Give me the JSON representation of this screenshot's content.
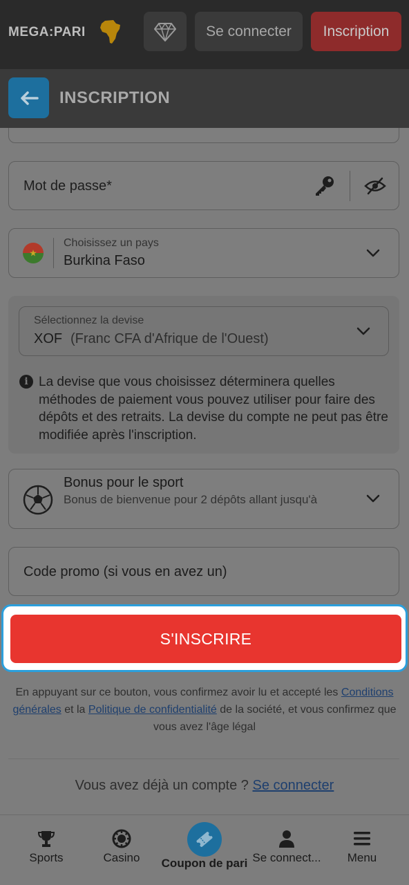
{
  "topbar": {
    "logo_text": "MEGA:PARI",
    "login_label": "Se connecter",
    "signup_label": "Inscription"
  },
  "header": {
    "title": "INSCRIPTION"
  },
  "form": {
    "password_placeholder": "Mot de passe*",
    "country": {
      "label": "Choisissez un pays",
      "value": "Burkina Faso"
    },
    "currency": {
      "label": "Sélectionnez la devise",
      "code": "XOF",
      "name": "(Franc CFA d'Afrique de l'Ouest)",
      "info": "La devise que vous choisissez déterminera quelles méthodes de paiement vous pouvez utiliser pour faire des dépôts et des retraits. La devise du compte ne peut pas être modifiée après l'inscription."
    },
    "bonus": {
      "title": "Bonus pour le sport",
      "description": "Bonus de bienvenue pour 2 dépôts allant jusqu'à"
    },
    "promo_placeholder": "Code promo (si vous en avez un)",
    "submit_label": "S'INSCRIRE"
  },
  "legal": {
    "part1": "En appuyant sur ce bouton, vous confirmez avoir lu et accepté les",
    "terms_link": "Conditions générales",
    "part2": "et la",
    "privacy_link": "Politique de confidentialité",
    "part3": "de la société, et vous confirmez que vous avez l'âge légal"
  },
  "already": {
    "text": "Vous avez déjà un compte ?",
    "link": "Se connecter"
  },
  "bottom_nav": {
    "items": [
      {
        "label": "Sports",
        "icon": "trophy-icon"
      },
      {
        "label": "Casino",
        "icon": "casino-chip-icon"
      },
      {
        "label": "Coupon de pari",
        "icon": "ticket-icon"
      },
      {
        "label": "Se connect...",
        "icon": "user-icon"
      },
      {
        "label": "Menu",
        "icon": "hamburger-icon"
      }
    ]
  },
  "colors": {
    "accent_red": "#e8352f",
    "accent_blue": "#1d6f9e",
    "highlight_border": "#2b9fdc"
  }
}
